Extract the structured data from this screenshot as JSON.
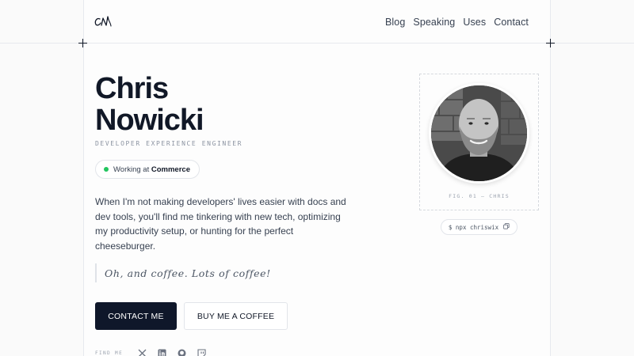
{
  "header": {
    "logo_alt": "CN",
    "nav": [
      "Blog",
      "Speaking",
      "Uses",
      "Contact"
    ]
  },
  "hero": {
    "first_name": "Chris",
    "last_name": "Nowicki",
    "role": "DEVELOPER EXPERIENCE ENGINEER",
    "badge_prefix": "Working at",
    "badge_company": "Commerce",
    "bio": "When I'm not making developers' lives easier with docs and dev tools, you'll find me tinkering with new tech, optimizing my productivity setup, or hunting for the perfect cheeseburger.",
    "quote": "Oh, and coffee. Lots of coffee!",
    "primary_button": "CONTACT ME",
    "secondary_button": "BUY ME A COFFEE",
    "find_me_label": "FIND ME"
  },
  "photo": {
    "caption": "FIG. 01 — CHRIS",
    "command": "$ npx chriswix"
  },
  "social_icons": [
    "x-icon",
    "linkedin-icon",
    "github-icon",
    "twitch-icon"
  ],
  "colors": {
    "accent": "#0f172a",
    "status_dot": "#22c55e",
    "background": "#fafafa"
  }
}
